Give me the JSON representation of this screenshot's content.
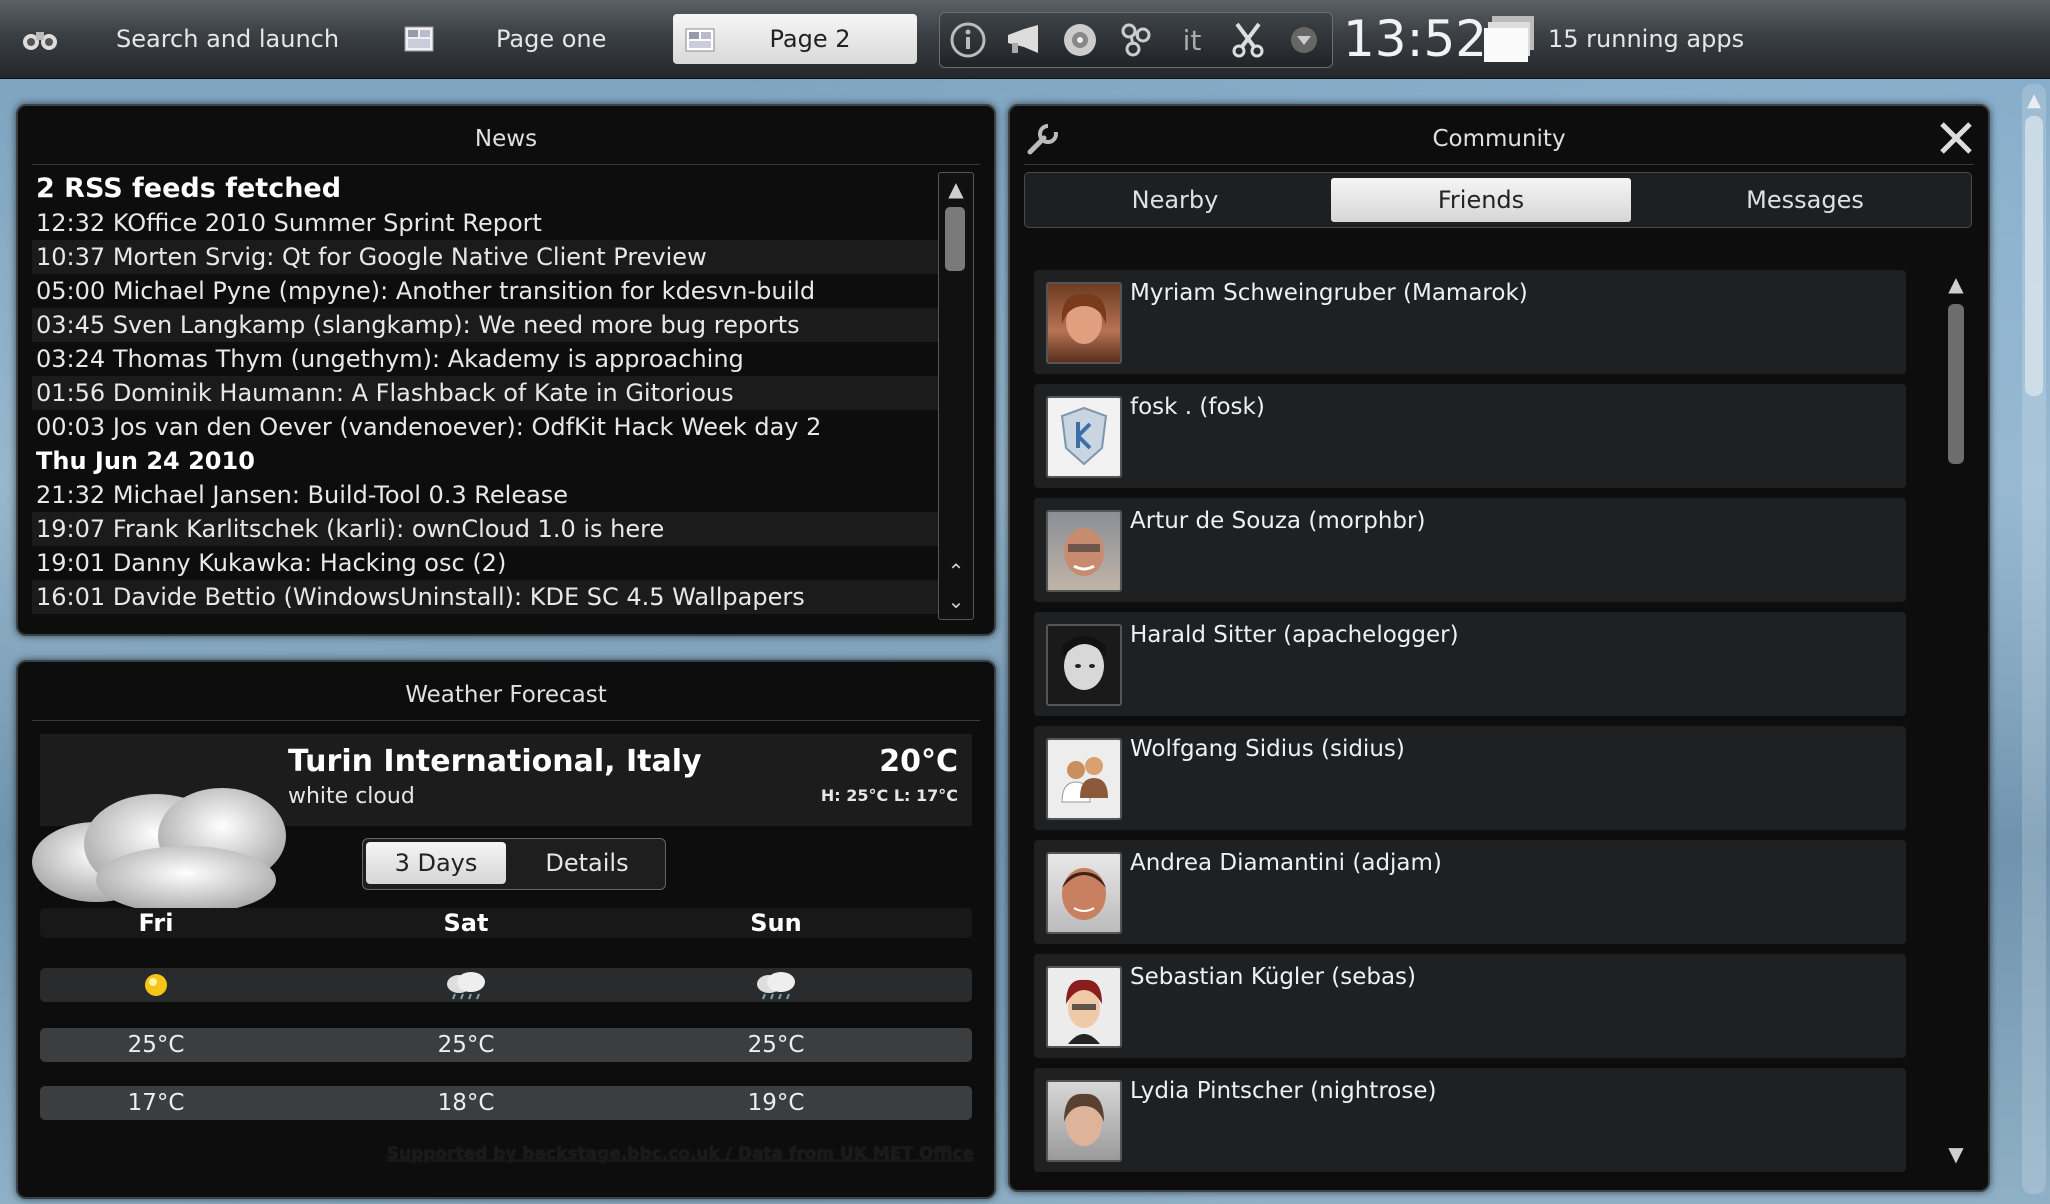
{
  "topbar": {
    "search_label": "Search and launch",
    "page_one_label": "Page one",
    "page_two_label": "Page 2",
    "tray_icons": [
      "info-icon",
      "megaphone-icon",
      "network-icon",
      "connection-icon",
      "it-icon",
      "cut-icon",
      "chevron-down-icon"
    ],
    "tray_it_text": "it",
    "clock": "13:52",
    "running_apps": "15 running apps"
  },
  "news": {
    "title": "News",
    "header": "2 RSS feeds fetched",
    "items": [
      {
        "time": "12:32",
        "text": "KOffice 2010 Summer Sprint Report"
      },
      {
        "time": "10:37",
        "text": "Morten Srvig: Qt for Google Native Client Preview"
      },
      {
        "time": "05:00",
        "text": "Michael Pyne (mpyne): Another transition for kdesvn-build"
      },
      {
        "time": "03:45",
        "text": "Sven Langkamp (slangkamp): We need more bug reports"
      },
      {
        "time": "03:24",
        "text": "Thomas Thym (ungethym): Akademy is approaching"
      },
      {
        "time": "01:56",
        "text": "Dominik Haumann: A Flashback of Kate in Gitorious"
      },
      {
        "time": "00:03",
        "text": "Jos van den Oever (vandenoever): OdfKit Hack Week day 2"
      }
    ],
    "date_header": "Thu Jun 24 2010",
    "items2": [
      {
        "time": "21:32",
        "text": "Michael Jansen: Build-Tool 0.3 Release"
      },
      {
        "time": "19:07",
        "text": "Frank Karlitschek (karli): ownCloud 1.0 is here"
      },
      {
        "time": "19:01",
        "text": "Danny Kukawka: Hacking osc (2)"
      },
      {
        "time": "16:01",
        "text": "Davide Bettio (WindowsUninstall): KDE SC 4.5 Wallpapers"
      }
    ]
  },
  "weather": {
    "title": "Weather Forecast",
    "location": "Turin International, Italy",
    "condition": "white cloud",
    "temp": "20°C",
    "hilo": "H: 25°C L: 17°C",
    "tab_active": "3 Days",
    "tab_other": "Details",
    "days": [
      {
        "name": "Fri",
        "icon": "sun-icon",
        "high": "25°C",
        "low": "17°C"
      },
      {
        "name": "Sat",
        "icon": "rain-cloud-icon",
        "high": "25°C",
        "low": "18°C"
      },
      {
        "name": "Sun",
        "icon": "rain-cloud-icon",
        "high": "25°C",
        "low": "19°C"
      }
    ],
    "credit": "Supported by backstage.bbc.co.uk / Data from UK MET Office"
  },
  "community": {
    "title": "Community",
    "tabs": [
      "Nearby",
      "Friends",
      "Messages"
    ],
    "active_tab": "Friends",
    "friends": [
      {
        "name": "Myriam Schweingruber (Mamarok)",
        "avatar": "photo"
      },
      {
        "name": "fosk . (fosk)",
        "avatar": "kde-shield"
      },
      {
        "name": "Artur de Souza (morphbr)",
        "avatar": "photo"
      },
      {
        "name": "Harald Sitter (apachelogger)",
        "avatar": "photo"
      },
      {
        "name": "Wolfgang Sidius (sidius)",
        "avatar": "default-people"
      },
      {
        "name": "Andrea Diamantini (adjam)",
        "avatar": "photo"
      },
      {
        "name": "Sebastian Kügler (sebas)",
        "avatar": "cartoon"
      },
      {
        "name": "Lydia Pintscher (nightrose)",
        "avatar": "photo"
      }
    ]
  },
  "colors": {
    "panel_bg": "#0d0d0e",
    "row_bg": "#1f2021",
    "active_tab": "#e8e8e8"
  }
}
